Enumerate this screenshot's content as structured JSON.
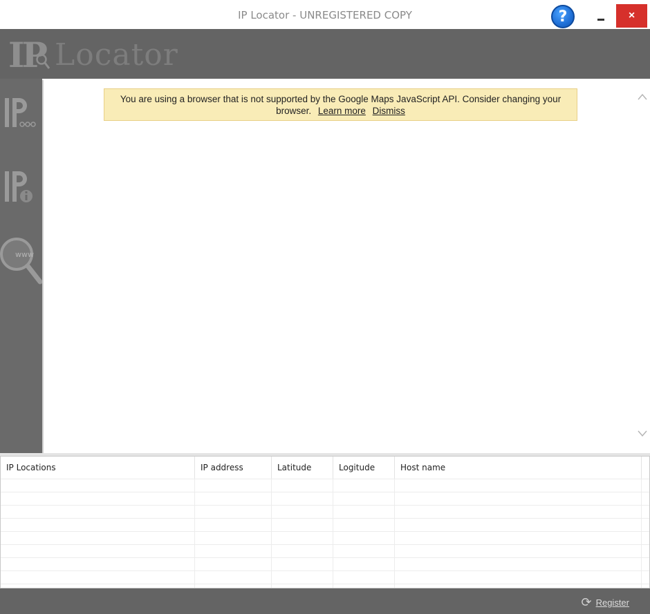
{
  "window": {
    "title": "IP Locator - UNREGISTERED COPY",
    "help_label": "?",
    "close_label": "×"
  },
  "header": {
    "logo_ip": "IP",
    "logo_text": "Locator"
  },
  "sidebar": {
    "items": [
      {
        "icon": "ip-network-icon"
      },
      {
        "icon": "ip-info-icon"
      },
      {
        "icon": "www-search-icon",
        "label": "www"
      }
    ]
  },
  "map": {
    "warning_text": "You are using a browser that is not supported by the Google Maps JavaScript API. Consider changing your browser.",
    "learn_more": "Learn more",
    "dismiss": "Dismiss"
  },
  "table": {
    "columns": [
      "IP Locations",
      "IP address",
      "Latitude",
      "Logitude",
      "Host name"
    ],
    "row_count": 10
  },
  "footer": {
    "register_label": "Register"
  },
  "colors": {
    "header_bg": "#646464",
    "close_red": "#d6302b",
    "warning_bg": "#f9ecb7",
    "help_blue": "#1f6fd6"
  }
}
